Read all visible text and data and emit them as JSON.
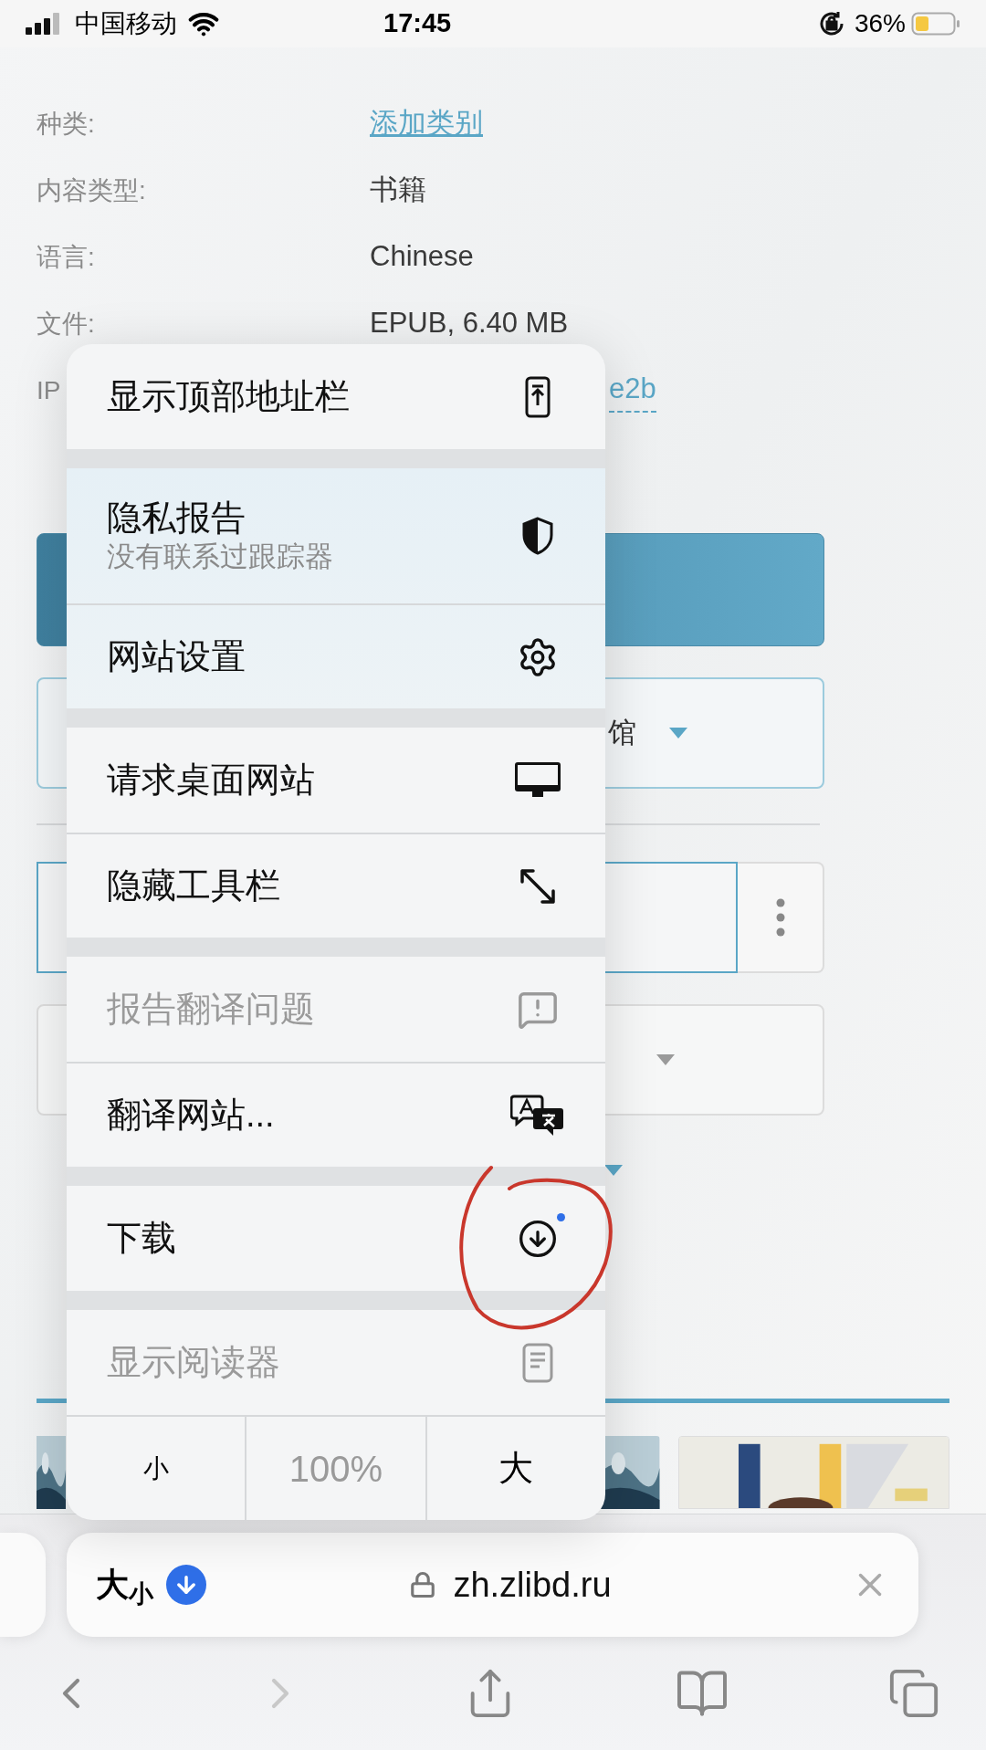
{
  "status_bar": {
    "carrier": "中国移动",
    "time": "17:45",
    "battery": "36%"
  },
  "details": [
    {
      "label": "种类:",
      "value": "添加类别",
      "kind": "link"
    },
    {
      "label": "内容类型:",
      "value": "书籍",
      "kind": "text"
    },
    {
      "label": "语言:",
      "value": "Chinese",
      "kind": "text"
    },
    {
      "label": "文件:",
      "value": "EPUB, 6.40 MB",
      "kind": "text"
    },
    {
      "label": "IP",
      "value": "e2b",
      "kind": "dotted_link"
    }
  ],
  "library_select": {
    "value": "馆"
  },
  "menu": {
    "groups": [
      {
        "items": [
          {
            "label": "显示顶部地址栏",
            "disabled": false,
            "notification_dot": false
          }
        ]
      },
      {
        "items": [
          {
            "label": "隐私报告",
            "subtitle": "没有联系过跟踪器",
            "disabled": false,
            "notification_dot": false
          },
          {
            "label": "网站设置",
            "disabled": false,
            "notification_dot": false
          }
        ]
      },
      {
        "items": [
          {
            "label": "请求桌面网站",
            "disabled": false,
            "notification_dot": false
          },
          {
            "label": "隐藏工具栏",
            "disabled": false,
            "notification_dot": false
          }
        ]
      },
      {
        "items": [
          {
            "label": "报告翻译问题",
            "disabled": true,
            "notification_dot": false
          },
          {
            "label": "翻译网站...",
            "disabled": false,
            "notification_dot": false
          }
        ]
      },
      {
        "items": [
          {
            "label": "下载",
            "disabled": false,
            "notification_dot": true
          }
        ]
      },
      {
        "items": [
          {
            "label": "显示阅读器",
            "disabled": true,
            "notification_dot": false
          }
        ]
      }
    ],
    "zoom_controls": [
      {
        "label": "小",
        "kind": "button"
      },
      {
        "label": "100%",
        "kind": "reading"
      },
      {
        "label": "大",
        "kind": "button"
      }
    ]
  },
  "address_bar": {
    "reader_label": "大$_{小}$",
    "url": "zh.zlibd.ru",
    "download_active": true
  }
}
